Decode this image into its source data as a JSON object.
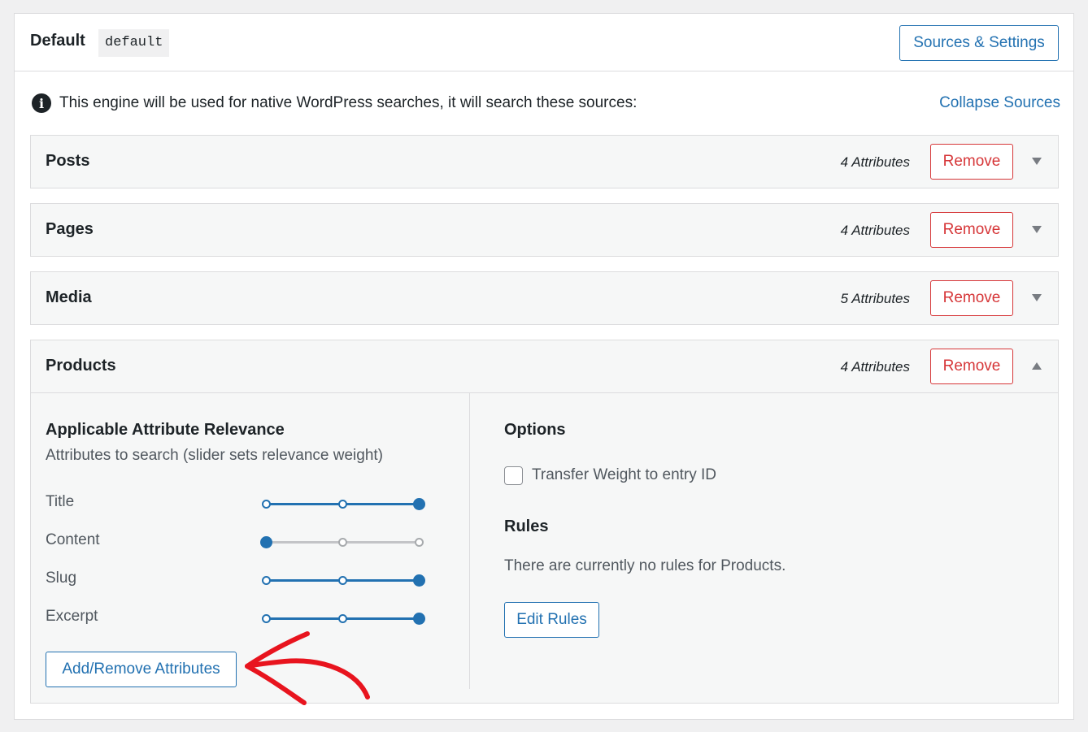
{
  "engine": {
    "title": "Default",
    "slug": "default",
    "sources_button": "Sources & Settings",
    "notice": "This engine will be used for native WordPress searches, it will search these sources:",
    "collapse_link": "Collapse Sources"
  },
  "sources": [
    {
      "name": "Posts",
      "attributes": "4 Attributes",
      "remove": "Remove",
      "expanded": false
    },
    {
      "name": "Pages",
      "attributes": "4 Attributes",
      "remove": "Remove",
      "expanded": false
    },
    {
      "name": "Media",
      "attributes": "5 Attributes",
      "remove": "Remove",
      "expanded": false
    },
    {
      "name": "Products",
      "attributes": "4 Attributes",
      "remove": "Remove",
      "expanded": true
    }
  ],
  "products": {
    "relevance_title": "Applicable Attribute Relevance",
    "relevance_subtitle": "Attributes to search (slider sets relevance weight)",
    "attributes": [
      {
        "label": "Title",
        "weight": 1.0
      },
      {
        "label": "Content",
        "weight": 0.0
      },
      {
        "label": "Slug",
        "weight": 1.0
      },
      {
        "label": "Excerpt",
        "weight": 1.0
      }
    ],
    "add_remove_button": "Add/Remove Attributes",
    "options_title": "Options",
    "transfer_weight_label": "Transfer Weight to entry ID",
    "transfer_weight_checked": false,
    "rules_title": "Rules",
    "rules_empty": "There are currently no rules for Products.",
    "edit_rules_button": "Edit Rules"
  },
  "colors": {
    "primary": "#2271b1",
    "danger": "#d63638",
    "annotation": "#e8141e"
  }
}
